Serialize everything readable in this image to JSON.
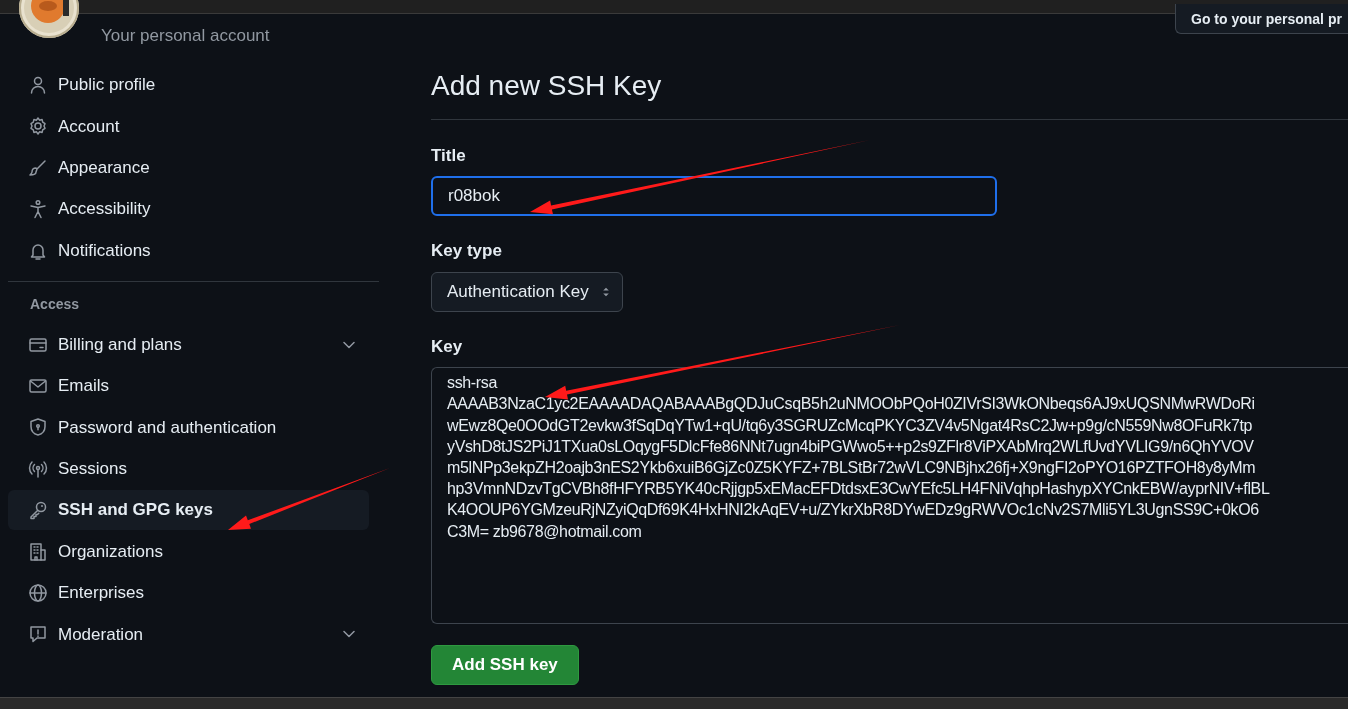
{
  "account": {
    "subtitle": "Your personal account",
    "profile_button": "Go to your personal pr"
  },
  "sidebar": {
    "groups": [
      {
        "items": [
          {
            "label": "Public profile",
            "selected": false
          },
          {
            "label": "Account",
            "selected": false
          },
          {
            "label": "Appearance",
            "selected": false
          },
          {
            "label": "Accessibility",
            "selected": false
          },
          {
            "label": "Notifications",
            "selected": false
          }
        ]
      },
      {
        "heading": "Access",
        "items": [
          {
            "label": "Billing and plans",
            "selected": false,
            "expanded": false
          },
          {
            "label": "Emails",
            "selected": false
          },
          {
            "label": "Password and authentication",
            "selected": false
          },
          {
            "label": "Sessions",
            "selected": false
          },
          {
            "label": "SSH and GPG keys",
            "selected": true
          },
          {
            "label": "Organizations",
            "selected": false
          },
          {
            "label": "Enterprises",
            "selected": false
          },
          {
            "label": "Moderation",
            "selected": false,
            "expanded": false
          }
        ]
      }
    ]
  },
  "form": {
    "heading": "Add new SSH Key",
    "title_field": {
      "label": "Title",
      "value": "r08bok",
      "focused": true
    },
    "key_type": {
      "label": "Key type",
      "value": "Authentication Key"
    },
    "key_field": {
      "label": "Key",
      "lines": [
        "ssh-rsa",
        "AAAAB3NzaC1yc2EAAAADAQABAAABgQDJuCsqB5h2uNMOObPQoH0ZIVrSI3WkONbeqs6AJ9xUQSNMwRWDoRi",
        "wEwz8Qe0OOdGT2evkw3fSqDqYTw1+qU/tq6y3SGRUZcMcqPKYC3ZV4v5Ngat4RsC2Jw+p9g/cN559Nw8OFuRk7tp",
        "yVshD8tJS2PiJ1TXua0sLOqygF5DlcFfe86NNt7ugn4biPGWwo5++p2s9ZFlr8ViPXAbMrq2WLfUvdYVLIG9/n6QhYVOV",
        "m5lNPp3ekpZH2oajb3nES2Ykb6xuiB6GjZc0Z5KYFZ+7BLStBr72wVLC9NBjhx26fj+X9ngFI2oPYO16PZTFOH8y8yMm",
        "hp3VmnNDzvTgCVBh8fHFYRB5YK40cRjjgp5xEMacEFDtdsxE3CwYEfc5LH4FNiVqhpHashypXYCnkEBW/ayprNIV+flBL",
        "K4OOUP6YGMzeuRjNZyiQqDf69K4HxHNI2kAqEV+u/ZYkrXbR8DYwEDz9gRWVOc1cNv2S7Mli5YL3UgnSS9C+0kO6",
        "C3M= zb9678@hotmail.com"
      ]
    },
    "submit": "Add SSH key"
  },
  "annotations": [
    {
      "kind": "arrow"
    },
    {
      "kind": "arrow"
    },
    {
      "kind": "arrow"
    }
  ]
}
